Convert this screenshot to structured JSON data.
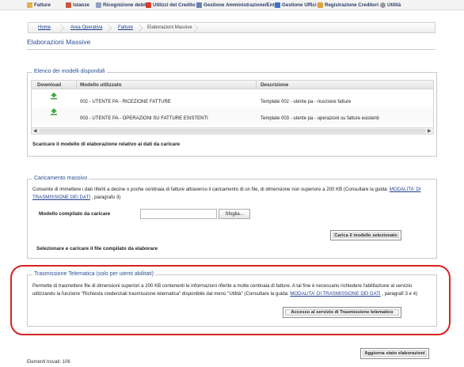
{
  "menu": {
    "items": [
      {
        "label": "Fatture",
        "icon": "invoice-icon",
        "color": "#e2b34a"
      },
      {
        "label": "Istanze",
        "icon": "request-icon",
        "color": "#c9583e"
      },
      {
        "label": "Ricognizione debiti",
        "icon": "document-icon",
        "color": "#8fa1c4"
      },
      {
        "label": "Utilizzi del Credito",
        "icon": "credit-usage-icon",
        "color": "#d63b2b"
      },
      {
        "label": "Gestione Amministrazione/Ente",
        "icon": "admin-icon",
        "color": "#6a7fb5"
      },
      {
        "label": "Gestione Uffici",
        "icon": "offices-icon",
        "color": "#3f74c9"
      },
      {
        "label": "Registrazione Creditori",
        "icon": "user-register-icon",
        "color": "#d9a441"
      },
      {
        "label": "Utilità",
        "icon": "utility-icon",
        "color": "#9a9a9a"
      }
    ]
  },
  "breadcrumb": {
    "home": "Home",
    "area": "Area Operativa",
    "section": "Fatture",
    "current": "Elaborazioni Massive"
  },
  "page": {
    "title": "Elaborazioni Massive"
  },
  "models": {
    "legend": "Elenco dei modelli disponibili",
    "columns": [
      "Download",
      "Modello utilizzato",
      "Descrizione"
    ],
    "rows": [
      {
        "model": "002 - UTENTE PA - RICEZIONE FATTURE",
        "description": "Template 002 - utente pa - ricezione fatture"
      },
      {
        "model": "003 - UTENTE PA - OPERAZIONI SU FATTURE ESISTENTI",
        "description": "Template 003 - utente pa - operazioni su fatture esistenti"
      }
    ],
    "note": "Scaricare il modello di elaborazione relativo ai dati da caricare",
    "scroll_left": "◀",
    "scroll_right": "▶"
  },
  "upload": {
    "legend": "Caricamento massivo",
    "text_before": "Consente di immettere i dati riferiti a decine o poche centinaia di fatture attraverso il caricamento di un file, di dimensione non superiore a 200 KB (Consultare la guida: ",
    "guide_link": "MODALITA' DI TRASMISSIONE DEI DATI",
    "text_after": " , paragrafo 3)",
    "field_label": "Modello compilato da caricare",
    "file_value": "",
    "browse_label": "Sfoglia...",
    "load_button": "Carica il modello selezionato",
    "note": "Selezionare e caricare il file compilato da elaborare"
  },
  "telematic": {
    "legend": "Trasmissione Telematica (solo per utenti abilitati)",
    "text_before": "Permette di trasmettere file di dimensioni superiori a 200 KB contenenti le informazioni riferite a molte centinaia di fatture. A tal fine è necessario richiedere l'abilitazione al servizio utilizzando la funzione \"Richiesta credenziali trasmissione telematica\" disponibile dal menù \"Utilità\" (Consultare la guida: ",
    "guide_link": "MODALITA' DI TRASMISSIONE DEI DATI",
    "text_after": " , paragrafi 3 e 4)",
    "access_button": "Accesso al servizio di Trasmissione telematico",
    "highlight_color": "#d62222"
  },
  "footer": {
    "refresh_button": "Aggiorna stato elaborazioni",
    "count_text": "Elementi trovati: 106"
  },
  "colors": {
    "title_blue": "#2c4f93",
    "link_blue": "#1d3f8f",
    "download_green": "#3aa23a"
  }
}
